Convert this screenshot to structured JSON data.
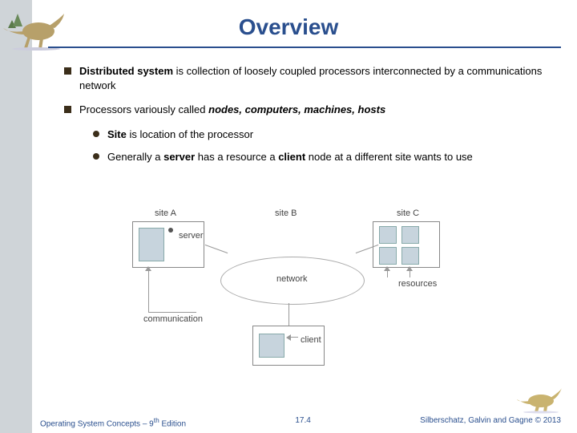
{
  "title": "Overview",
  "bullets": {
    "b1": {
      "p1": "Distributed system",
      "p2": " is collection of loosely coupled processors interconnected by a communications network"
    },
    "b2": {
      "p1": "Processors variously called ",
      "p2": "nodes, computers, machines, hosts"
    },
    "b2a": {
      "p1": "Site",
      "p2": " is location of the processor"
    },
    "b2b": {
      "p1": "Generally a ",
      "p2": "server",
      "p3": " has a resource a ",
      "p4": "client",
      "p5": " node at a different site wants to use"
    }
  },
  "diagram": {
    "siteA": "site A",
    "siteB": "site B",
    "siteC": "site C",
    "server": "server",
    "client": "client",
    "network": "network",
    "resources": "resources",
    "communication": "communication"
  },
  "footer": {
    "left_a": "Operating System Concepts – 9",
    "left_b": "th",
    "left_c": " Edition",
    "center": "17.4",
    "right_a": "Silberschatz, Galvin and Gagne ",
    "right_b": "©",
    "right_c": " 2013"
  }
}
